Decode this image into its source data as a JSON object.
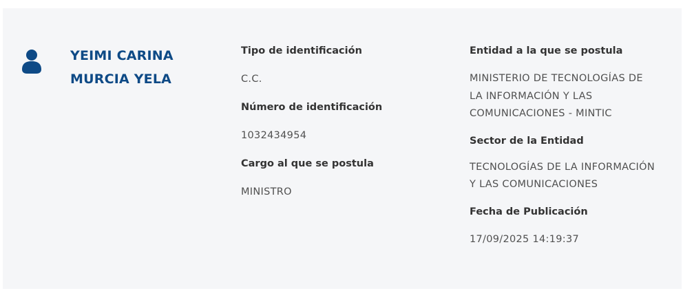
{
  "candidate": {
    "name_line1": "YEIMI CARINA",
    "name_line2": "MURCIA YELA",
    "icon": "user-icon",
    "accent_color": "#0e4a86"
  },
  "middle": {
    "id_type_label": "Tipo de identificación",
    "id_type_value": "C.C.",
    "id_number_label": "Número de identificación",
    "id_number_value": "1032434954",
    "position_label": "Cargo al que se postula",
    "position_value": "MINISTRO"
  },
  "right": {
    "entity_label": "Entidad a la que se postula",
    "entity_value_line1": "MINISTERIO DE TECNOLOGÍAS DE",
    "entity_value_line2": "LA INFORMACIÓN Y LAS",
    "entity_value_line3": "COMUNICACIONES - MINTIC",
    "sector_label": "Sector de la Entidad",
    "sector_value_line1": "TECNOLOGÍAS DE LA INFORMACIÓN",
    "sector_value_line2": "Y LAS COMUNICACIONES",
    "date_label": "Fecha de Publicación",
    "date_value": "17/09/2025 14:19:37"
  }
}
